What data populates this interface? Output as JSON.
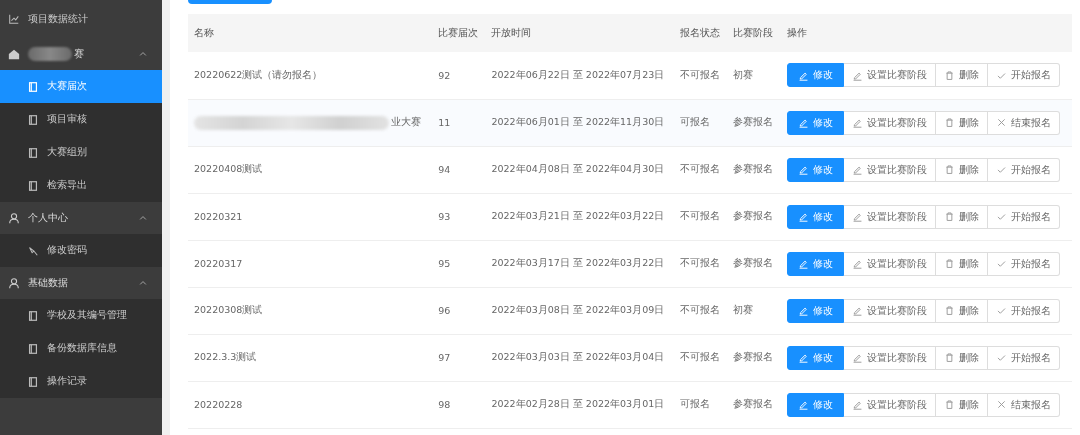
{
  "sidebar": {
    "items": [
      {
        "kind": "link",
        "label": "项目数据统计"
      },
      {
        "kind": "group",
        "label": "赛",
        "redacted": true,
        "expanded": true,
        "children": [
          {
            "label": "大赛届次",
            "selected": true
          },
          {
            "label": "项目审核",
            "selected": false
          },
          {
            "label": "大赛组别",
            "selected": false
          },
          {
            "label": "检索导出",
            "selected": false
          }
        ]
      },
      {
        "kind": "group",
        "label": "个人中心",
        "expanded": true,
        "children": [
          {
            "label": "修改密码",
            "selected": false
          }
        ]
      },
      {
        "kind": "group",
        "label": "基础数据",
        "expanded": true,
        "children": [
          {
            "label": "学校及其编号管理",
            "selected": false
          },
          {
            "label": "备份数据库信息",
            "selected": false
          },
          {
            "label": "操作记录",
            "selected": false
          }
        ]
      }
    ]
  },
  "table": {
    "columns": [
      "名称",
      "比赛届次",
      "开放时间",
      "报名状态",
      "比赛阶段",
      "操作"
    ],
    "rows": [
      {
        "name": "20220622测试（请勿报名）",
        "round": "92",
        "period": "2022年06月22日 至 2022年07月23日",
        "status": "不可报名",
        "stage": "初赛",
        "highlighted": false,
        "actions": [
          {
            "kind": "edit",
            "label": "修改"
          },
          {
            "kind": "stage",
            "label": "设置比赛阶段"
          },
          {
            "kind": "delete",
            "label": "删除"
          },
          {
            "kind": "start",
            "label": "开始报名"
          }
        ]
      },
      {
        "name": "业大赛",
        "redacted": true,
        "round": "11",
        "period": "2022年06月01日 至 2022年11月30日",
        "status": "可报名",
        "stage": "参赛报名",
        "highlighted": true,
        "actions": [
          {
            "kind": "edit",
            "label": "修改"
          },
          {
            "kind": "stage",
            "label": "设置比赛阶段"
          },
          {
            "kind": "delete",
            "label": "删除"
          },
          {
            "kind": "end",
            "label": "结束报名"
          }
        ]
      },
      {
        "name": "20220408测试",
        "round": "94",
        "period": "2022年04月08日 至 2022年04月30日",
        "status": "不可报名",
        "stage": "参赛报名",
        "highlighted": false,
        "actions": [
          {
            "kind": "edit",
            "label": "修改"
          },
          {
            "kind": "stage",
            "label": "设置比赛阶段"
          },
          {
            "kind": "delete",
            "label": "删除"
          },
          {
            "kind": "start",
            "label": "开始报名"
          }
        ]
      },
      {
        "name": "20220321",
        "round": "93",
        "period": "2022年03月21日 至 2022年03月22日",
        "status": "不可报名",
        "stage": "参赛报名",
        "highlighted": false,
        "actions": [
          {
            "kind": "edit",
            "label": "修改"
          },
          {
            "kind": "stage",
            "label": "设置比赛阶段"
          },
          {
            "kind": "delete",
            "label": "删除"
          },
          {
            "kind": "start",
            "label": "开始报名"
          }
        ]
      },
      {
        "name": "20220317",
        "round": "95",
        "period": "2022年03月17日 至 2022年03月22日",
        "status": "不可报名",
        "stage": "参赛报名",
        "highlighted": false,
        "actions": [
          {
            "kind": "edit",
            "label": "修改"
          },
          {
            "kind": "stage",
            "label": "设置比赛阶段"
          },
          {
            "kind": "delete",
            "label": "删除"
          },
          {
            "kind": "start",
            "label": "开始报名"
          }
        ]
      },
      {
        "name": "20220308测试",
        "round": "96",
        "period": "2022年03月08日 至 2022年03月09日",
        "status": "不可报名",
        "stage": "初赛",
        "highlighted": false,
        "actions": [
          {
            "kind": "edit",
            "label": "修改"
          },
          {
            "kind": "stage",
            "label": "设置比赛阶段"
          },
          {
            "kind": "delete",
            "label": "删除"
          },
          {
            "kind": "start",
            "label": "开始报名"
          }
        ]
      },
      {
        "name": "2022.3.3测试",
        "round": "97",
        "period": "2022年03月03日 至 2022年03月04日",
        "status": "不可报名",
        "stage": "参赛报名",
        "highlighted": false,
        "actions": [
          {
            "kind": "edit",
            "label": "修改"
          },
          {
            "kind": "stage",
            "label": "设置比赛阶段"
          },
          {
            "kind": "delete",
            "label": "删除"
          },
          {
            "kind": "start",
            "label": "开始报名"
          }
        ]
      },
      {
        "name": "20220228",
        "round": "98",
        "period": "2022年02月28日 至 2022年03月01日",
        "status": "可报名",
        "stage": "参赛报名",
        "highlighted": false,
        "actions": [
          {
            "kind": "edit",
            "label": "修改"
          },
          {
            "kind": "stage",
            "label": "设置比赛阶段"
          },
          {
            "kind": "delete",
            "label": "删除"
          },
          {
            "kind": "end",
            "label": "结束报名"
          }
        ]
      }
    ]
  }
}
